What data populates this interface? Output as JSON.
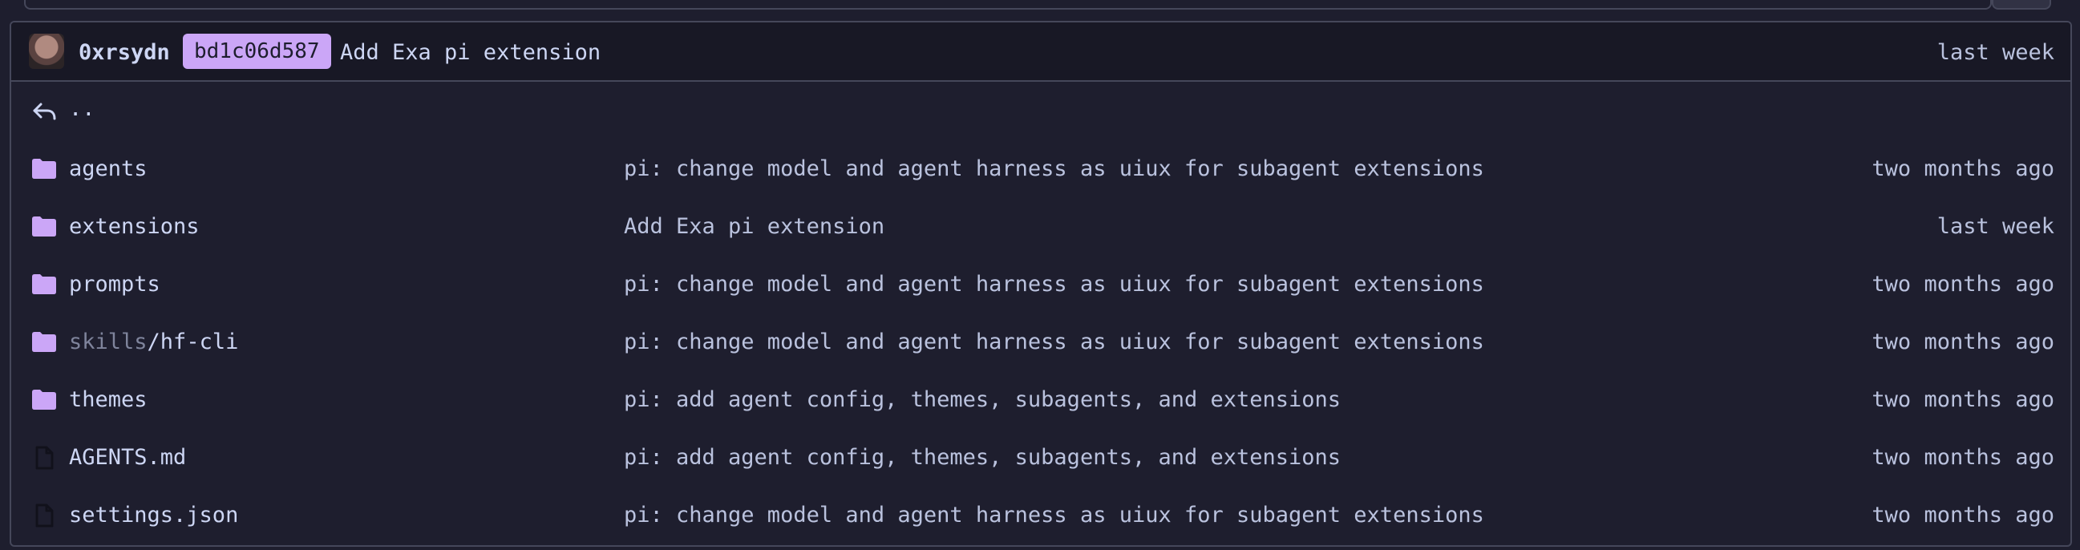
{
  "commit": {
    "author": "0xrsydn",
    "sha": "bd1c06d587",
    "message": "Add Exa pi extension",
    "time": "last week"
  },
  "parent_link": {
    "label": ".."
  },
  "entries": [
    {
      "type": "folder",
      "name": "agents",
      "message": "pi: change model and agent harness as uiux for subagent extensions",
      "time": "two months ago"
    },
    {
      "type": "folder",
      "name": "extensions",
      "message": "Add Exa pi extension",
      "time": "last week"
    },
    {
      "type": "folder",
      "name": "prompts",
      "message": "pi: change model and agent harness as uiux for subagent extensions",
      "time": "two months ago"
    },
    {
      "type": "folder",
      "name_prefix": "skills",
      "name_suffix": "/hf-cli",
      "message": "pi: change model and agent harness as uiux for subagent extensions",
      "time": "two months ago"
    },
    {
      "type": "folder",
      "name": "themes",
      "message": "pi: add agent config, themes, subagents, and extensions",
      "time": "two months ago"
    },
    {
      "type": "file",
      "name": "AGENTS.md",
      "message": "pi: add agent config, themes, subagents, and extensions",
      "time": "two months ago"
    },
    {
      "type": "file",
      "name": "settings.json",
      "message": "pi: change model and agent harness as uiux for subagent extensions",
      "time": "two months ago"
    }
  ],
  "colors": {
    "background": "#1e1e2e",
    "commit_bar": "#181825",
    "border": "#45475a",
    "accent": "#cba6f7",
    "text": "#cdd6f4",
    "muted_text": "#bac2de",
    "dim_text": "#7f849c"
  },
  "icons": {
    "folder": "folder-icon",
    "file": "file-icon",
    "parent": "return-arrow-icon"
  }
}
